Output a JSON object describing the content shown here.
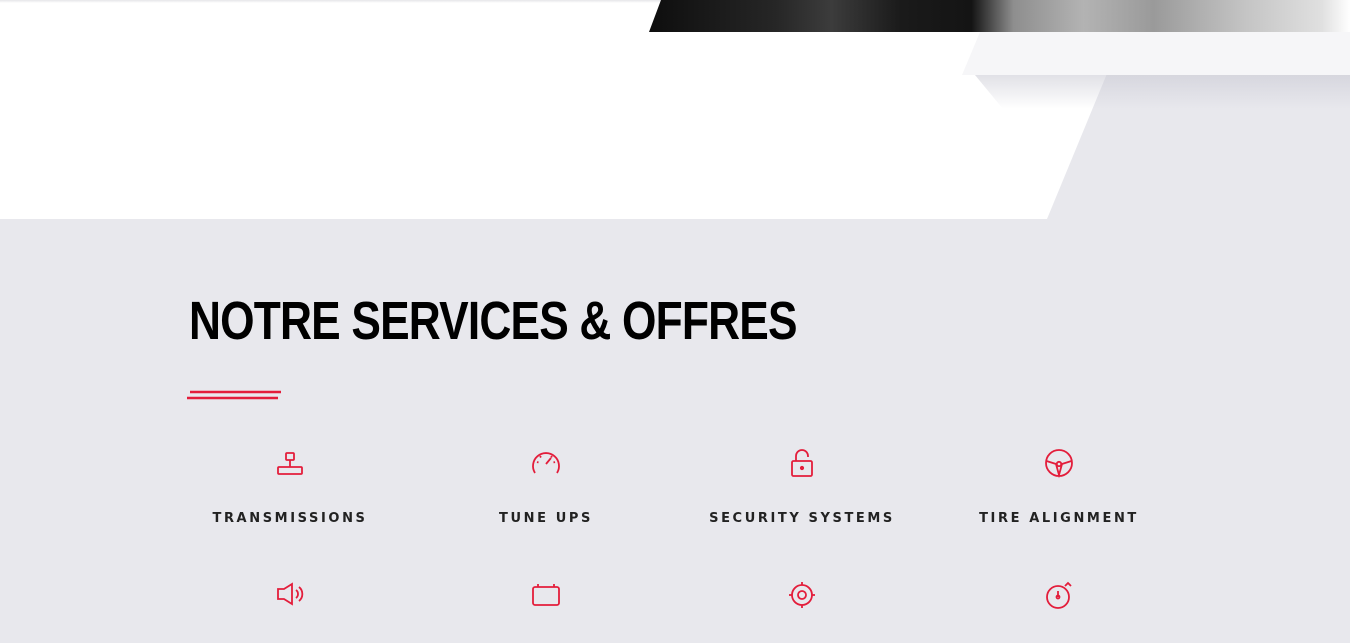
{
  "section": {
    "title": "NOTRE SERVICES & OFFRES"
  },
  "colors": {
    "accent": "#e31d3b",
    "background": "#e8e8ed",
    "heading": "#000000",
    "label": "#222222"
  },
  "services": [
    {
      "label": "TRANSMISSIONS",
      "icon": "joystick-icon"
    },
    {
      "label": "TUNE UPS",
      "icon": "speedometer-icon"
    },
    {
      "label": "SECURITY SYSTEMS",
      "icon": "padlock-icon"
    },
    {
      "label": "TIRE ALIGNMENT",
      "icon": "steering-wheel-icon"
    },
    {
      "label": "",
      "icon": "horn-icon"
    },
    {
      "label": "",
      "icon": "battery-icon"
    },
    {
      "label": "",
      "icon": "gear-icon"
    },
    {
      "label": "",
      "icon": "stopwatch-icon"
    }
  ]
}
